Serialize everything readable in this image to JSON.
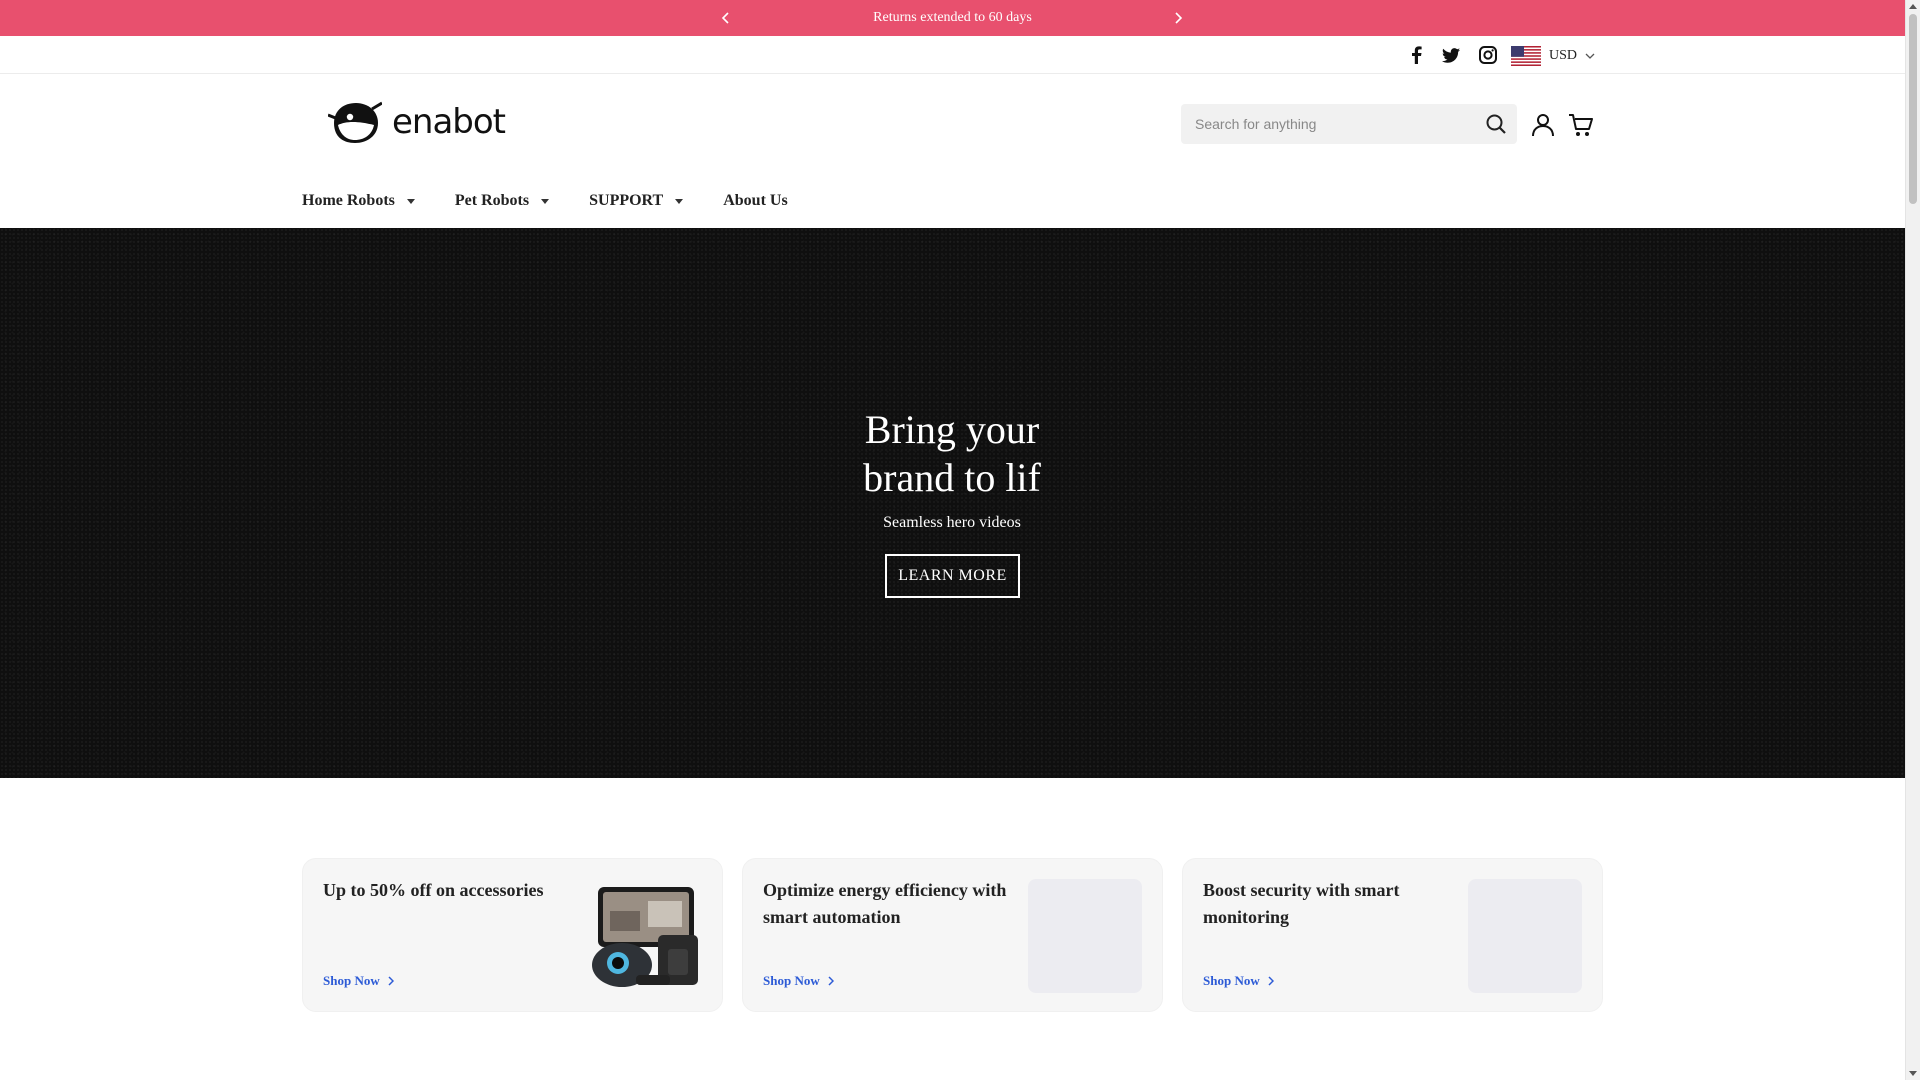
{
  "announcement": {
    "message": "Returns extended to 60 days",
    "bg_color": "#e8506e"
  },
  "utility": {
    "social_icons": [
      "facebook-icon",
      "twitter-icon",
      "instagram-icon"
    ],
    "currency": "USD"
  },
  "header": {
    "brand": "enabot",
    "search_placeholder": "Search for anything"
  },
  "nav": {
    "items": [
      {
        "label": "Home Robots",
        "dropdown": true
      },
      {
        "label": "Pet Robots",
        "dropdown": true
      },
      {
        "label": "SUPPORT",
        "dropdown": true
      },
      {
        "label": "About Us",
        "dropdown": false
      }
    ]
  },
  "hero": {
    "title_line1": "Bring your",
    "title_line2": "brand to lif",
    "subtitle": "Seamless hero videos",
    "cta": "LEARN MORE"
  },
  "promos": [
    {
      "heading": "Up to 50% off on accessories",
      "link": "Shop Now"
    },
    {
      "heading": "Optimize energy efficiency with smart automation",
      "link": "Shop Now"
    },
    {
      "heading": "Boost security with smart monitoring",
      "link": "Shop Now"
    }
  ],
  "colors": {
    "accent": "#e8506e",
    "link": "#2d5bd6",
    "hero_bg": "#0f0f0f"
  }
}
